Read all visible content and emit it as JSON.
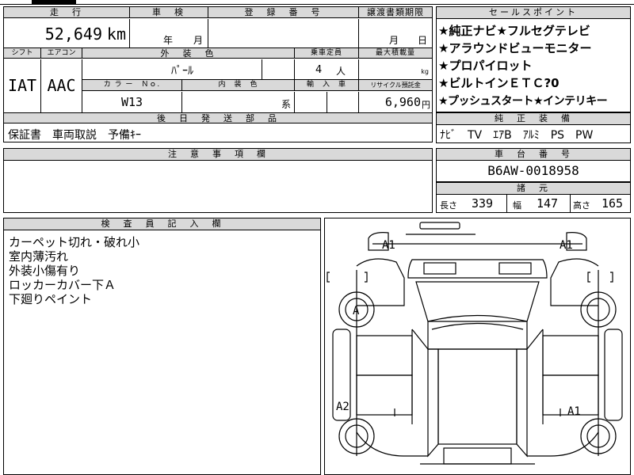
{
  "header": {
    "mileage_label": "走　行",
    "inspection_label": "車　検",
    "registration_label": "登　録　番　号",
    "transfer_label": "譲渡書類期限",
    "sales_points_label": "セールスポイント"
  },
  "mileage": {
    "value": "52,649",
    "unit": "km"
  },
  "inspection": {
    "year_unit": "年",
    "month_unit": "月"
  },
  "transfer": {
    "month_unit": "月",
    "day_unit": "日"
  },
  "sales_points": [
    "★純正ナビ★フルセグテレビ",
    "★アラウンドビューモニター",
    "★プロパイロット",
    "★ビルトインＥＴＣ?0",
    "★プッシュスタート★インテリキー"
  ],
  "row2_labels": {
    "shift": "シフト",
    "aircon": "エアコン",
    "exterior_color": "外　装　色",
    "capacity": "乗車定員",
    "max_load": "最大積載量",
    "color_no": "カ ラ ー　Ｎｏ.",
    "interior_color": "内　装　色",
    "import": "輸　入　車",
    "recycle": "リサイクル預託金"
  },
  "row2_values": {
    "shift": "IAT",
    "aircon": "AAC",
    "exterior_color": "ﾊﾟｰﾙ",
    "capacity_value": "4",
    "capacity_unit": "人",
    "max_load_unit": "kg",
    "color_no": "W13",
    "interior_suffix": "系",
    "recycle_value": "6,960",
    "recycle_unit": "円"
  },
  "later_parts": {
    "label": "後　日　発　送　部　品",
    "value": "保証書　車両取説　予備ｷｰ"
  },
  "equipment": {
    "label": "純　正　装　備",
    "value": "ﾅﾋﾞ　TV　ｴｱB　ｱﾙﾐ　PS　PW"
  },
  "notes": {
    "label": "注　意　事　項　欄"
  },
  "chassis": {
    "label": "車　台　番　号",
    "value": "B6AW-0018958"
  },
  "dimensions": {
    "label": "諸　元",
    "length_label": "長さ",
    "length": "339",
    "width_label": "幅",
    "width": "147",
    "height_label": "高さ",
    "height": "165"
  },
  "inspector": {
    "label": "検　査　員　記　入　欄",
    "lines": [
      "カーペット切れ・破れ小",
      "室内薄汚れ",
      "外装小傷有り",
      "ロッカーカバー下Ａ",
      "下廻りペイント"
    ]
  },
  "diagram_marks": {
    "front_left": "A1",
    "front_right": "A1",
    "wheel_front_left": "A",
    "rear_left": "A2",
    "right_side": "A1"
  }
}
